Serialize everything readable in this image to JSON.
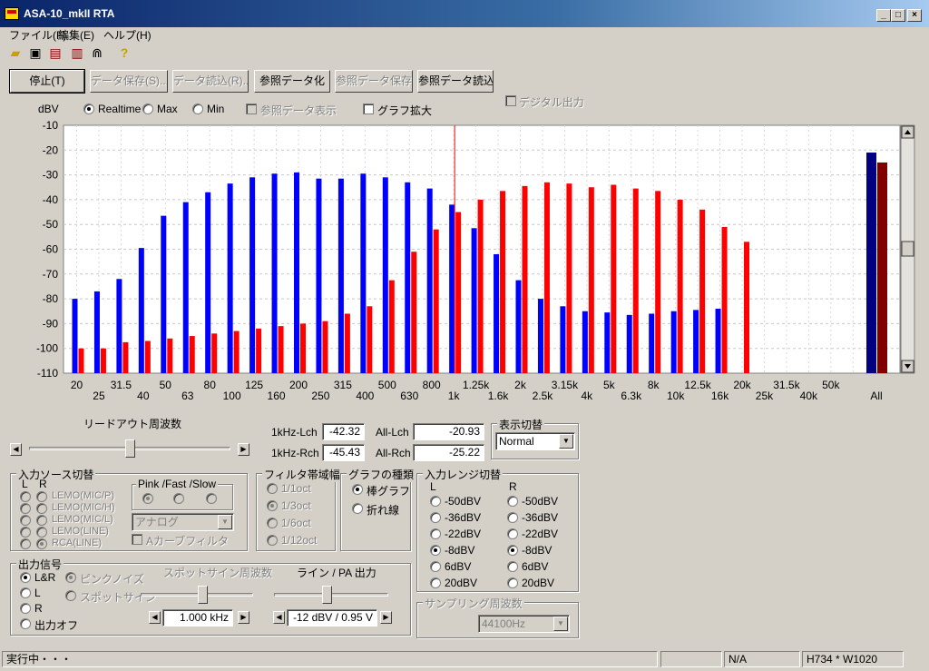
{
  "window": {
    "title": "ASA-10_mkII RTA"
  },
  "menu": [
    "ファイル(F)",
    "編集(E)",
    "ヘルプ(H)"
  ],
  "toolbar_icons": [
    "open-folder-icon",
    "save-disk-icon",
    "print-icon",
    "export-icon",
    "meter-icon",
    "help-icon"
  ],
  "buttons": {
    "stop": "停止(T)",
    "data_save": "データ保存(S)...",
    "data_load": "データ読込(R)...",
    "ref_data": "参照データ化",
    "ref_save": "参照データ保存",
    "ref_load": "参照データ読込"
  },
  "mode": {
    "unit": "dBV",
    "realtime": "Realtime",
    "max": "Max",
    "min": "Min",
    "ref_show": "参照データ表示",
    "graph_zoom": "グラフ拡大",
    "digital_out": "デジタル出力"
  },
  "chart_data": {
    "type": "bar",
    "ylabel": "dBV",
    "ylim": [
      -110,
      -10
    ],
    "yticks": [
      -10,
      -20,
      -30,
      -40,
      -50,
      -60,
      -70,
      -80,
      -90,
      -100,
      -110
    ],
    "x_top": [
      "20",
      "31.5",
      "50",
      "80",
      "125",
      "200",
      "315",
      "500",
      "800",
      "1.25k",
      "2k",
      "3.15k",
      "5k",
      "8k",
      "12.5k",
      "20k",
      "31.5k",
      "50k"
    ],
    "x_bottom": [
      "25",
      "40",
      "63",
      "100",
      "160",
      "250",
      "400",
      "630",
      "1k",
      "1.6k",
      "2.5k",
      "4k",
      "6.3k",
      "10k",
      "16k",
      "25k",
      "40k"
    ],
    "all_label": "All",
    "cursor_freq": "1k",
    "series": [
      {
        "name": "L",
        "color": "#0000ff",
        "values": [
          -80,
          -77,
          -72,
          -59.5,
          -46.5,
          -41,
          -37,
          -33.5,
          -31,
          -29.5,
          -29,
          -31.5,
          -31.5,
          -29.5,
          -31,
          -33,
          -35.5,
          -42,
          -51.5,
          -62,
          -72.5,
          -80,
          -83,
          -85,
          -85.5,
          -86.5,
          -86,
          -85,
          -84.5,
          -84,
          null,
          null,
          null,
          null,
          null,
          null
        ]
      },
      {
        "name": "R",
        "color": "#ff0000",
        "values": [
          -100,
          -100,
          -97.5,
          -97,
          -96,
          -95,
          -94,
          -93,
          -92,
          -91,
          -90,
          -89,
          -86,
          -83,
          -72.5,
          -61,
          -52,
          -45,
          -40,
          -36.5,
          -34.5,
          -33,
          -33.5,
          -35,
          -34,
          -35.5,
          -36.5,
          -40,
          -44,
          -51,
          -57,
          null,
          null,
          null,
          null,
          null
        ]
      }
    ],
    "all": {
      "L": -21,
      "R": -25,
      "L_color": "#000080",
      "R_color": "#800000"
    }
  },
  "readouts": {
    "k1_lch_label": "1kHz-Lch",
    "k1_lch": "-42.32",
    "k1_rch_label": "1kHz-Rch",
    "k1_rch": "-45.43",
    "all_lch_label": "All-Lch",
    "all_lch": "-20.93",
    "all_rch_label": "All-Rch",
    "all_rch": "-25.22"
  },
  "readout_freq": {
    "label": "リードアウト周波数"
  },
  "display_switch": {
    "title": "表示切替",
    "value": "Normal"
  },
  "input_source": {
    "title": "入力ソース切替",
    "L": "L",
    "R": "R",
    "items": [
      "LEMO(MIC/P)",
      "LEMO(MIC/H)",
      "LEMO(MIC/L)",
      "LEMO(LINE)",
      "RCA(LINE)"
    ],
    "pink_title": "Pink /Fast /Slow",
    "analog_value": "アナログ",
    "a_curve": "Aカーブフィルタ"
  },
  "filter_bw": {
    "title": "フィルタ帯域幅",
    "items": [
      "1/1oct",
      "1/3oct",
      "1/6oct",
      "1/12oct"
    ]
  },
  "graph_type": {
    "title": "グラフの種類",
    "items": [
      "棒グラフ",
      "折れ線"
    ]
  },
  "input_range": {
    "title": "入力レンジ切替",
    "L": "L",
    "R": "R",
    "items": [
      "-50dBV",
      "-36dBV",
      "-22dBV",
      "-8dBV",
      "6dBV",
      "20dBV"
    ]
  },
  "output": {
    "title": "出力信号",
    "items": [
      "L&R",
      "L",
      "R",
      "出力オフ"
    ],
    "pink_noise": "ピンクノイズ",
    "spot_sine": "スポットサイン",
    "spot_freq_label": "スポットサイン周波数",
    "spot_freq_value": "1.000 kHz",
    "line_pa_label": "ライン / PA 出力",
    "line_pa_value": "-12 dBV / 0.95 V"
  },
  "sampling": {
    "title": "サンプリング周波数",
    "value": "44100Hz"
  },
  "status": {
    "state": "実行中・・・",
    "na": "N/A",
    "size": "H734 * W1020"
  }
}
